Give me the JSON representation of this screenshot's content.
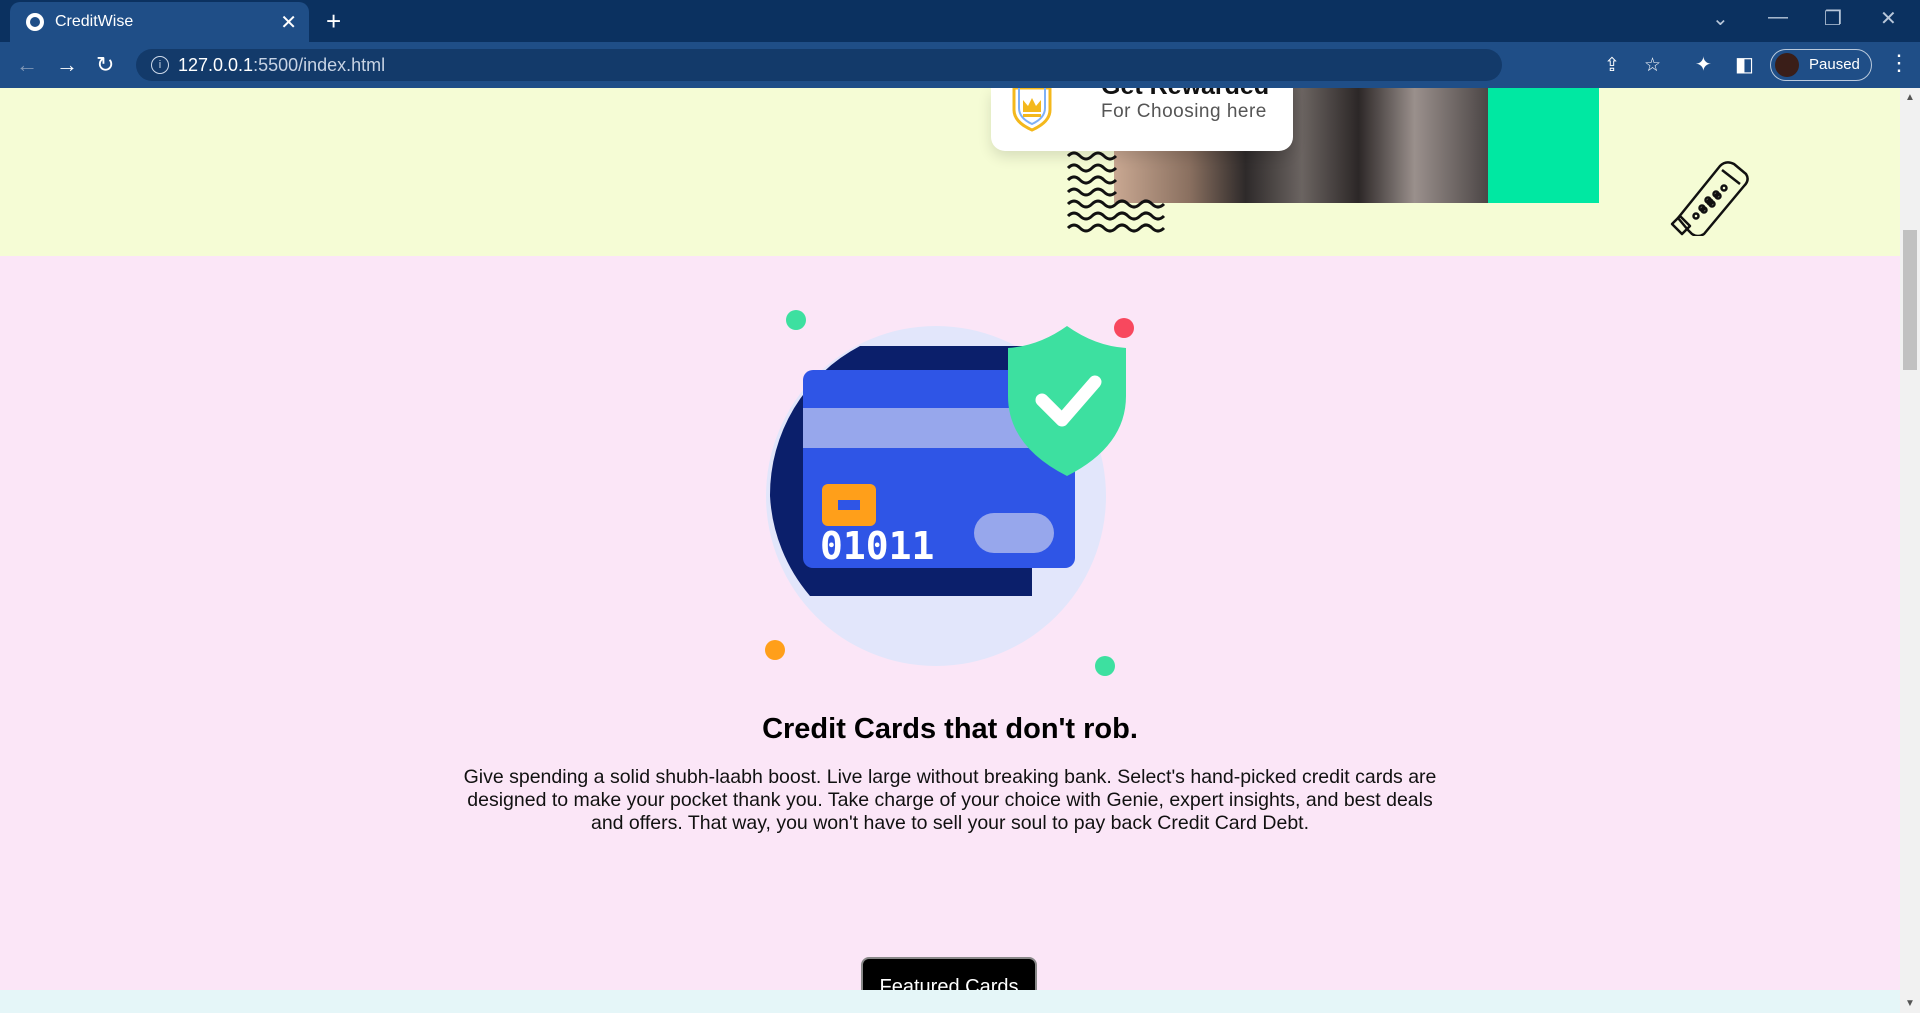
{
  "browser": {
    "tab_title": "CreditWise",
    "url_host": "127.0.0.1",
    "url_path": ":5500/index.html",
    "profile_label": "Paused"
  },
  "hero": {
    "reward_title": "Get Rewarded",
    "reward_subtitle": "For Choosing here"
  },
  "card_illustration": {
    "card_number": "01011"
  },
  "section": {
    "headline": "Credit Cards that don't rob.",
    "description": "Give spending a solid shubh-laabh boost. Live large without breaking bank. Select's hand-picked credit cards are designed to make your pocket thank you. Take charge of your choice with Genie, expert insights, and best deals and offers. That way, you won't have to sell your soul to pay back Credit Card Debt.",
    "cta_label": "Featured Cards"
  },
  "colors": {
    "chrome_dark": "#0b3160",
    "chrome_toolbar": "#1f4e87",
    "hero_bg": "#f5fcd5",
    "section_bg": "#fbe6f7",
    "accent_green": "#00e8a2",
    "card_blue": "#2f55e6",
    "shield_green": "#3de0a0"
  }
}
